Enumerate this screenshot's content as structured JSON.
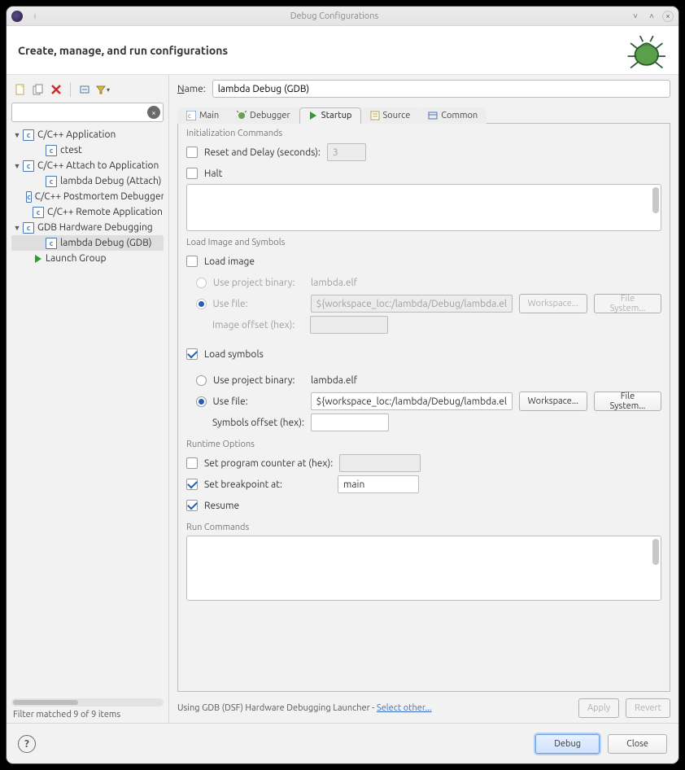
{
  "window": {
    "title": "Debug Configurations"
  },
  "header": {
    "title": "Create, manage, and run configurations"
  },
  "sidebar": {
    "filter_value": "",
    "filter_status": "Filter matched 9 of 9 items"
  },
  "tree": [
    {
      "label": "C/C++ Application",
      "children": [
        "ctest"
      ]
    },
    {
      "label": "C/C++ Attach to Application",
      "children": [
        "lambda Debug (Attach)"
      ]
    },
    {
      "label": "C/C++ Postmortem Debugger"
    },
    {
      "label": "C/C++ Remote Application"
    },
    {
      "label": "GDB Hardware Debugging",
      "children": [
        "lambda Debug (GDB)"
      ]
    },
    {
      "label": "Launch Group"
    }
  ],
  "config": {
    "name": "lambda Debug (GDB)"
  },
  "tabs": [
    "Main",
    "Debugger",
    "Startup",
    "Source",
    "Common"
  ],
  "startup": {
    "init": {
      "title": "Initialization Commands",
      "reset_label": "Reset and Delay (seconds):",
      "reset_value": "3",
      "halt_label": "Halt"
    },
    "load": {
      "title": "Load Image and Symbols",
      "load_image_label": "Load image",
      "use_project_binary_label": "Use project binary:",
      "use_file_label": "Use file:",
      "image_project_binary": "lambda.elf",
      "image_file_placeholder": "${workspace_loc:/lambda/Debug/lambda.elf}",
      "image_offset_label": "Image offset (hex):",
      "load_symbols_label": "Load symbols",
      "symbols_project_binary": "lambda.elf",
      "symbols_file_value": "${workspace_loc:/lambda/Debug/lambda.elf}",
      "symbols_offset_label": "Symbols offset (hex):",
      "workspace_btn": "Workspace...",
      "filesystem_btn": "File System..."
    },
    "runtime": {
      "title": "Runtime Options",
      "set_pc_label": "Set program counter at (hex):",
      "set_bp_label": "Set breakpoint at:",
      "set_bp_value": "main",
      "resume_label": "Resume"
    },
    "run": {
      "title": "Run Commands"
    }
  },
  "launcher": {
    "text": "Using GDB (DSF) Hardware Debugging Launcher - ",
    "link": "Select other...",
    "apply": "Apply",
    "revert": "Revert"
  },
  "footer": {
    "debug": "Debug",
    "close": "Close"
  }
}
